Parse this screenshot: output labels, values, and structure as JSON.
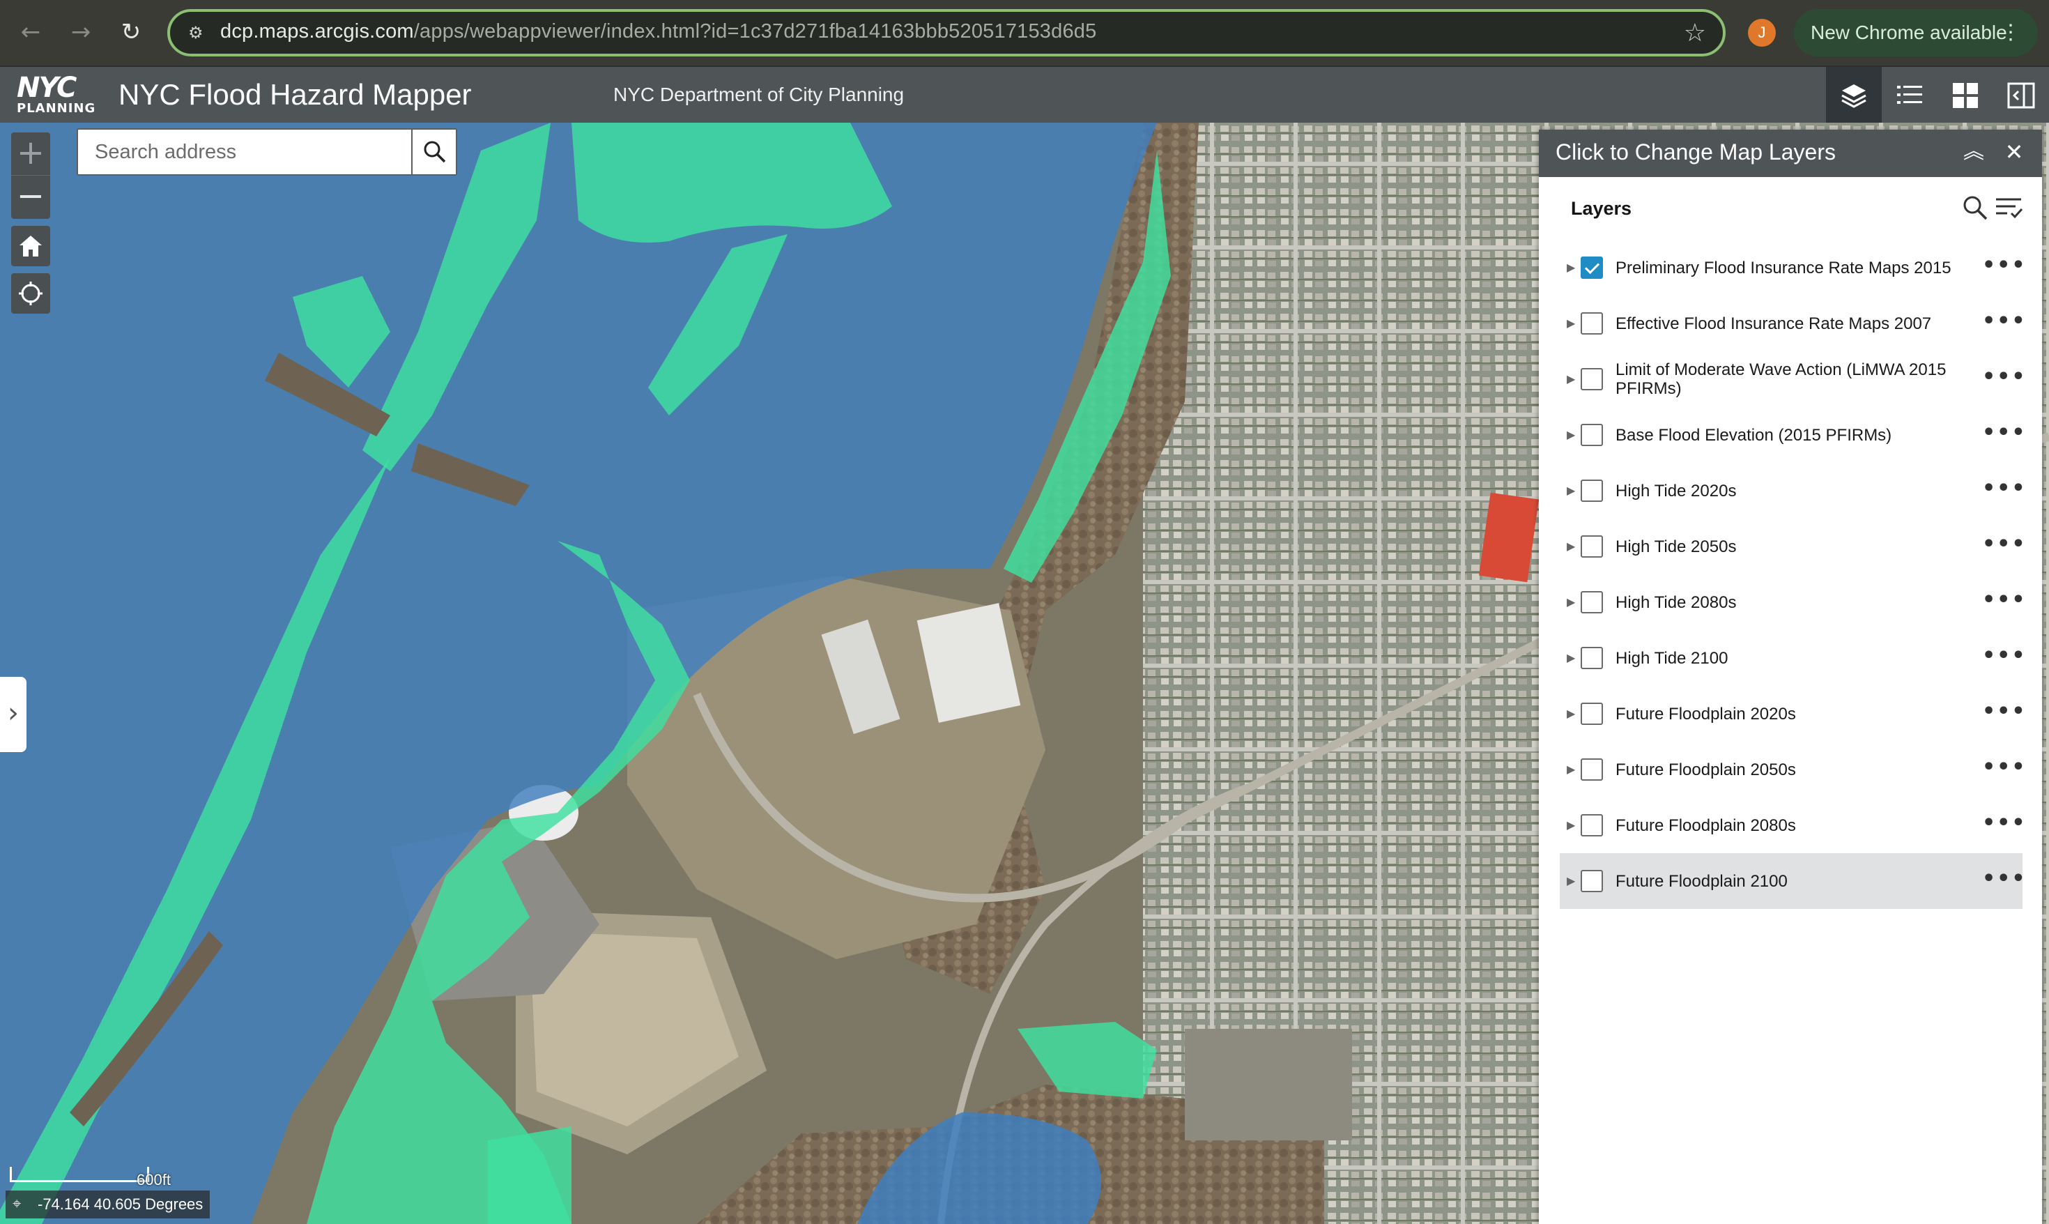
{
  "browser": {
    "url_host": "dcp.maps.arcgis.com",
    "url_path": "/apps/webappviewer/index.html?id=1c37d271fba14163bbb520517153d6d5",
    "profile_initial": "J",
    "update_label": "New Chrome available",
    "icons": [
      "back-arrow-icon",
      "forward-arrow-icon",
      "reload-icon",
      "site-settings-icon",
      "bookmark-star-icon",
      "kebab-menu-icon"
    ]
  },
  "header": {
    "logo_top": "NYC",
    "logo_bottom": "PLANNING",
    "title": "NYC Flood Hazard Mapper",
    "subtitle": "NYC Department of City Planning",
    "tools": [
      "layer-list-icon",
      "legend-icon",
      "basemap-gallery-icon",
      "swipe-icon"
    ]
  },
  "map": {
    "zoom_in": "+",
    "zoom_out": "−",
    "search_placeholder": "Search address",
    "scale_label": "600ft",
    "coordinates": "-74.164 40.605 Degrees",
    "colors": {
      "flood_blue": "#3f7fbf",
      "flood_green": "#3ee0a0"
    }
  },
  "panel": {
    "title": "Click to Change Map Layers",
    "layers_heading": "Layers",
    "layers": [
      {
        "name": "Preliminary Flood Insurance Rate Maps 2015",
        "checked": true
      },
      {
        "name": "Effective Flood Insurance Rate Maps 2007",
        "checked": false
      },
      {
        "name": "Limit of Moderate Wave Action (LiMWA 2015 PFIRMs)",
        "checked": false
      },
      {
        "name": "Base Flood Elevation (2015 PFIRMs)",
        "checked": false
      },
      {
        "name": "High Tide 2020s",
        "checked": false
      },
      {
        "name": "High Tide 2050s",
        "checked": false
      },
      {
        "name": "High Tide 2080s",
        "checked": false
      },
      {
        "name": "High Tide 2100",
        "checked": false
      },
      {
        "name": "Future Floodplain 2020s",
        "checked": false
      },
      {
        "name": "Future Floodplain 2050s",
        "checked": false
      },
      {
        "name": "Future Floodplain 2080s",
        "checked": false
      },
      {
        "name": "Future Floodplain 2100",
        "checked": false
      }
    ],
    "selected_index": 11
  }
}
